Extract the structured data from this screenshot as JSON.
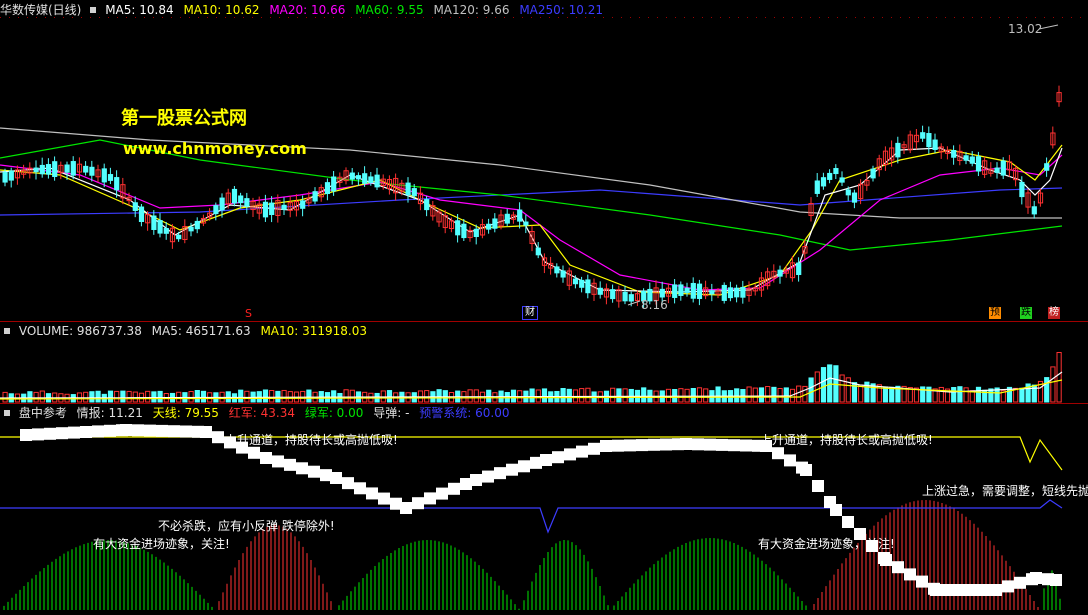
{
  "main_header": {
    "title": "华数传媒(日线)",
    "ma5": "MA5: 10.84",
    "ma10": "MA10: 10.62",
    "ma20": "MA20: 10.66",
    "ma60": "MA60: 9.55",
    "ma120": "MA120: 9.66",
    "ma250": "MA250: 10.21"
  },
  "volume_header": {
    "volume": "VOLUME: 986737.38",
    "ma5": "MA5: 465171.63",
    "ma10": "MA10: 311918.03"
  },
  "indicator_header": {
    "name": "盘中参考",
    "qingbao": "情报: 11.21",
    "tianxian": "天线: 79.55",
    "hongjun": "红军: 43.34",
    "lvjun": "绿军: 0.00",
    "daodan": "导弹: -",
    "yujing": "预警系统: 60.00"
  },
  "watermark": {
    "line1": "第一股票公式网",
    "line2": "www.chnmoney.com"
  },
  "price_labels": {
    "high": "13.02",
    "low": "8.16"
  },
  "markers": {
    "s": "S",
    "caibao": "财",
    "yu": "预",
    "die": "跌",
    "bang": "榜"
  },
  "notes": {
    "up_channel_1": "上升通道，持股待长或高抛低吸!",
    "up_channel_2": "上升通道，持股待长或高抛低吸!",
    "no_sell": "不必杀跌，应有小反弹 跌停除外!",
    "big_money_1": "有大资金进场迹象，关注!",
    "big_money_2": "有大资金进场迹象，关注!",
    "overheat": "上涨过急，需要调整，短线先抛"
  },
  "colors": {
    "up": "#ff3232",
    "down": "#54ffff",
    "ma5": "#ffffff",
    "ma10": "#ffff00",
    "ma20": "#ff00ff",
    "ma60": "#00e600",
    "ma120": "#c0c0c0",
    "ma250": "#3c3cff"
  }
}
